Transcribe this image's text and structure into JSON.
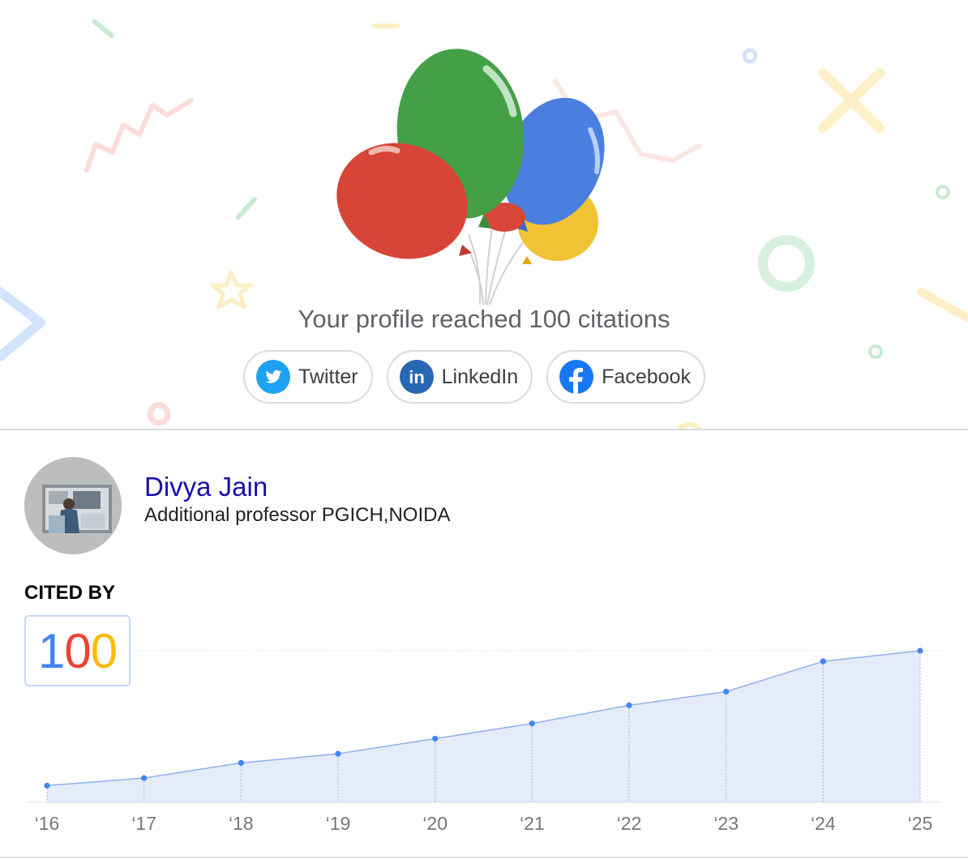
{
  "banner": {
    "milestone_text": "Your profile reached 100 citations",
    "share_buttons": [
      {
        "label": "Twitter",
        "icon": "twitter-icon",
        "color": "#1da1f2"
      },
      {
        "label": "LinkedIn",
        "icon": "linkedin-icon",
        "color": "#2867b2"
      },
      {
        "label": "Facebook",
        "icon": "facebook-icon",
        "color": "#1877f2"
      }
    ],
    "balloon_colors": [
      "#d93025",
      "#34a853",
      "#4285f4",
      "#fbbc04"
    ]
  },
  "profile": {
    "name": "Divya Jain",
    "affiliation": "Additional professor PGICH,NOIDA",
    "cited_by_label": "CITED BY",
    "cited_count_digits": [
      "1",
      "0",
      "0"
    ],
    "digit_colors": [
      "#4285f4",
      "#ea4335",
      "#fbbc04"
    ]
  },
  "chart_data": {
    "type": "area",
    "categories": [
      "‘16",
      "‘17",
      "‘18",
      "‘19",
      "‘20",
      "‘21",
      "‘22",
      "‘23",
      "‘24",
      "‘25"
    ],
    "values": [
      11,
      16,
      26,
      32,
      42,
      52,
      64,
      73,
      93,
      100
    ],
    "ylim": [
      0,
      100
    ],
    "color": "#4285f4",
    "fill": "#e4ecfa"
  }
}
